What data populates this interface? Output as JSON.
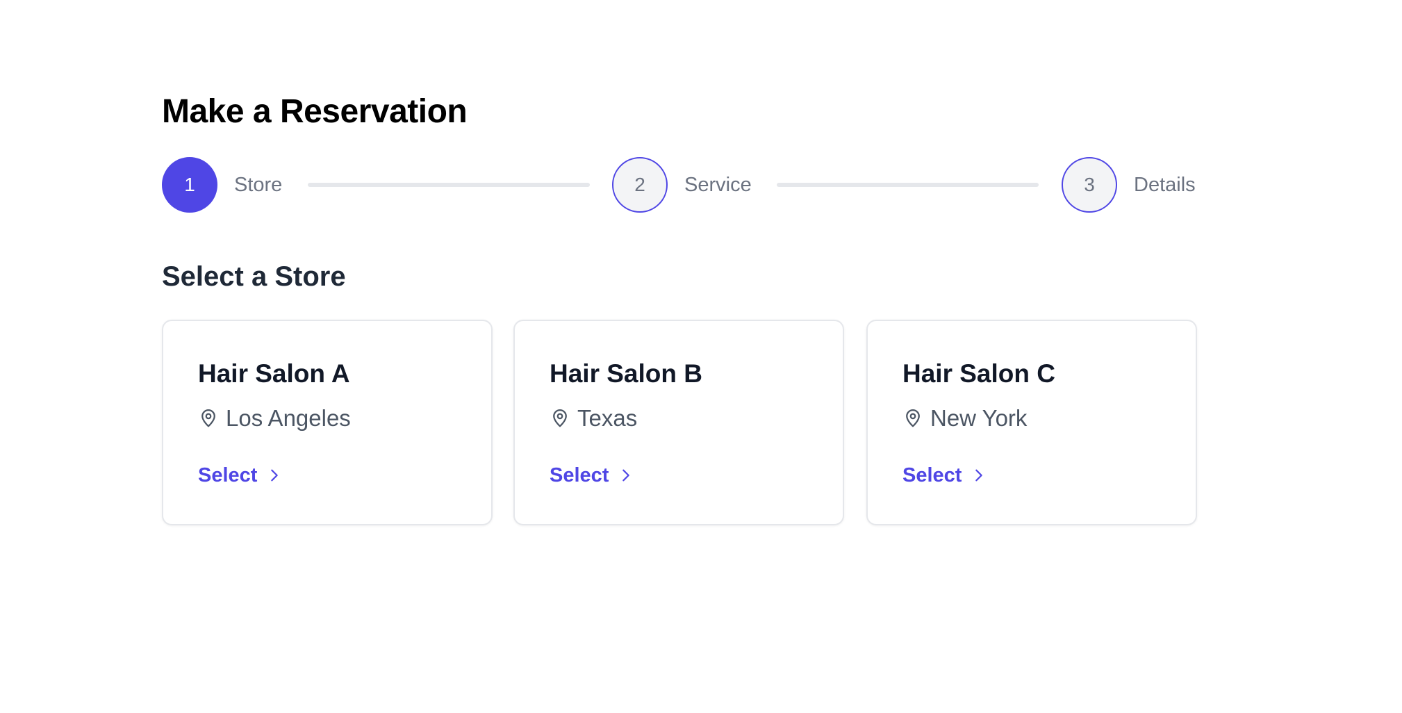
{
  "page": {
    "title": "Make a Reservation"
  },
  "stepper": {
    "steps": [
      {
        "number": "1",
        "label": "Store",
        "state": "active"
      },
      {
        "number": "2",
        "label": "Service",
        "state": "pending"
      },
      {
        "number": "3",
        "label": "Details",
        "state": "pending"
      }
    ]
  },
  "section": {
    "title": "Select a Store"
  },
  "stores": [
    {
      "name": "Hair Salon A",
      "location": "Los Angeles",
      "action_label": "Select"
    },
    {
      "name": "Hair Salon B",
      "location": "Texas",
      "action_label": "Select"
    },
    {
      "name": "Hair Salon C",
      "location": "New York",
      "action_label": "Select"
    }
  ],
  "icons": {
    "location": "map-pin-icon",
    "select": "chevron-right-icon"
  },
  "colors": {
    "accent": "#4f46e5",
    "step_pending_bg": "#f3f4f6",
    "step_line": "#e5e7eb",
    "muted_text": "#6b7280",
    "card_border": "#e5e7eb"
  }
}
